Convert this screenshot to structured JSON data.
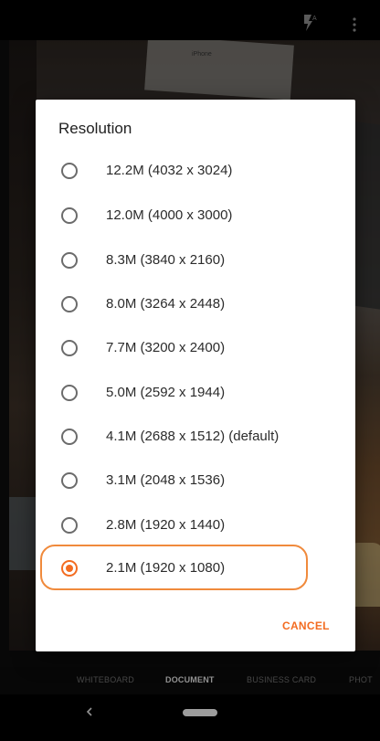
{
  "dialog": {
    "title": "Resolution",
    "options": [
      {
        "label": "12.2M (4032 x 3024)",
        "selected": false
      },
      {
        "label": "12.0M (4000 x 3000)",
        "selected": false
      },
      {
        "label": "8.3M (3840 x 2160)",
        "selected": false
      },
      {
        "label": "8.0M (3264 x 2448)",
        "selected": false
      },
      {
        "label": "7.7M (3200 x 2400)",
        "selected": false
      },
      {
        "label": "5.0M (2592 x 1944)",
        "selected": false
      },
      {
        "label": "4.1M (2688 x 1512) (default)",
        "selected": false
      },
      {
        "label": "3.1M (2048 x 1536)",
        "selected": false
      },
      {
        "label": "2.8M (1920 x 1440)",
        "selected": false
      },
      {
        "label": "2.1M (1920 x 1080)",
        "selected": true
      }
    ],
    "cancel_label": "CANCEL"
  },
  "preview": {
    "paper_label": "iPhone"
  },
  "modes": {
    "items": [
      {
        "label": "WHITEBOARD",
        "active": false
      },
      {
        "label": "DOCUMENT",
        "active": true
      },
      {
        "label": "BUSINESS CARD",
        "active": false
      },
      {
        "label": "PHOT",
        "active": false
      }
    ]
  },
  "icons": {
    "flash": "flash-auto-icon",
    "overflow": "more-vert-icon",
    "back": "back-icon"
  },
  "colors": {
    "accent": "#f36c21",
    "highlight": "#f08a3c",
    "dialog_bg": "#ffffff"
  }
}
